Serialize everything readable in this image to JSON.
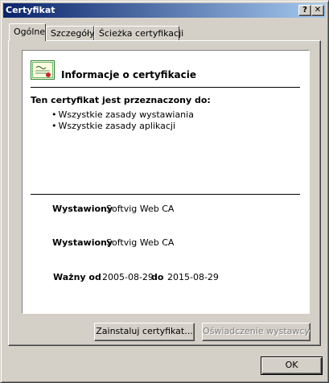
{
  "window": {
    "title": "Certyfikat",
    "help_glyph": "?",
    "close_glyph": "✕"
  },
  "tabs": [
    {
      "label": "Ogólne",
      "active": true
    },
    {
      "label": "Szczegóły",
      "active": false
    },
    {
      "label": "Ścieżka certyfikacji",
      "active": false
    }
  ],
  "general": {
    "info_title": "Informacje o certyfikacie",
    "purpose_heading": "Ten certyfikat jest przeznaczony do:",
    "purposes": [
      "Wszystkie zasady wystawiania",
      "Wszystkie zasady aplikacji"
    ],
    "issued_to_label": "Wystawiony",
    "issued_to_value": "Softvig Web CA",
    "issued_by_label": "Wystawiony",
    "issued_by_value": "Softvig Web CA",
    "valid_from_label": "Ważny od",
    "valid_from_value": "2005-08-29",
    "valid_to_label": "do",
    "valid_to_value": "2015-08-29"
  },
  "buttons": {
    "install": "Zainstaluj certyfikat...",
    "statement": "Oświadczenie wystawcy",
    "ok": "OK"
  },
  "icons": {
    "certificate": "certificate-icon",
    "help": "help-icon",
    "close": "close-icon"
  }
}
